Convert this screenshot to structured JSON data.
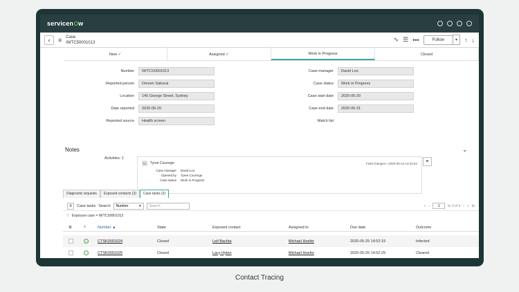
{
  "brand": "servicenow",
  "header": {
    "record_type": "Case",
    "record_number": "IWTC50001013",
    "follow_label": "Follow"
  },
  "stages": [
    {
      "label": "New ✓"
    },
    {
      "label": "Assigned ✓"
    },
    {
      "label": "Work in Progress"
    },
    {
      "label": "Closed"
    }
  ],
  "fields_left": [
    {
      "label": "Number",
      "value": "IWTCS0001013"
    },
    {
      "label": "Reported person",
      "value": "Doreen Sakurai"
    },
    {
      "label": "Location",
      "value": "140 George Street, Sydney"
    },
    {
      "label": "Date reported",
      "value": "2020-05-20"
    },
    {
      "label": "Reported source",
      "value": "Health screen"
    }
  ],
  "fields_right": [
    {
      "label": "Case manager",
      "value": "David Loo"
    },
    {
      "label": "Case status",
      "value": "Work in Progress"
    },
    {
      "label": "Case start date",
      "value": "2020-05-20"
    },
    {
      "label": "Case end date",
      "value": "2020-05-31"
    },
    {
      "label": "Watch list",
      "value": ""
    }
  ],
  "notes": {
    "title": "Notes",
    "activities_label": "Activities: 1",
    "author_initials": "TC",
    "author": "Tyree Courrege",
    "meta": "Field changes • 2020-05-13 13:33:52",
    "changes": [
      {
        "k": "Case manager",
        "v": "David Loo"
      },
      {
        "k": "Opened by",
        "v": "Tyree Courrege"
      },
      {
        "k": "Case status",
        "v": "Work in Progress"
      }
    ]
  },
  "tabs": [
    "Diagnostic requests",
    "Exposed contacts (3)",
    "Case tasks (3)"
  ],
  "list": {
    "title": "Case tasks",
    "search_label": "Search",
    "search_field": "Number",
    "search_placeholder": "Search",
    "page_current": "1",
    "page_of": "to 3 of 3",
    "breadcrumb": "Exposure case = IWTCS0001013",
    "columns": [
      "Number ▲",
      "State",
      "Exposed contact",
      "Assigned to",
      "Due date",
      "Outcome"
    ],
    "rows": [
      {
        "number": "CTSK0001024",
        "state": "Closed",
        "contact": "Leif Bachta",
        "assigned": "Michael Hoefer",
        "due": "2020-05-25 14:52:19",
        "outcome": "Infected"
      },
      {
        "number": "CTSK0001025",
        "state": "Closed",
        "contact": "Lacy Hyten",
        "assigned": "Michael Hoefer",
        "due": "2020-05-26 14:52:29",
        "outcome": "Cleared"
      }
    ]
  },
  "caption": "Contact Tracing"
}
